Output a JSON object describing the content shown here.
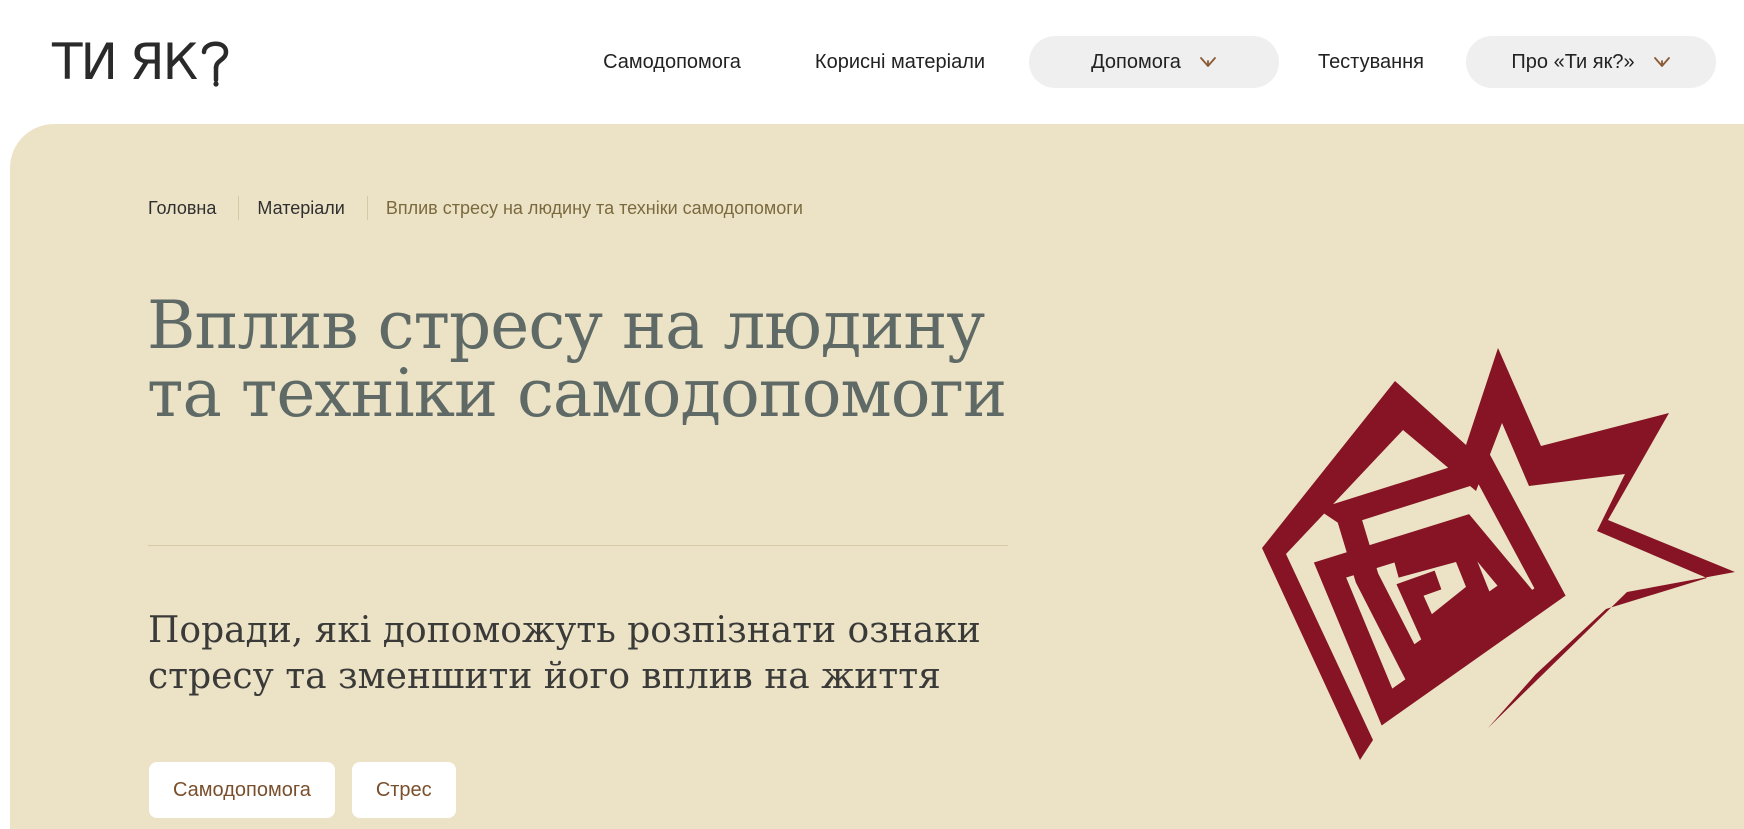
{
  "logo": {
    "text": "ТИ ЯК"
  },
  "nav": {
    "items": [
      {
        "label": "Самодопомога"
      },
      {
        "label": "Корисні матеріали"
      },
      {
        "label": "Допомога"
      },
      {
        "label": "Тестування"
      },
      {
        "label": "Про «Ти як?»"
      }
    ]
  },
  "breadcrumb": {
    "home": "Головна",
    "materials": "Матеріали",
    "current": "Вплив стресу на людину та техніки самодопомоги"
  },
  "article": {
    "title": "Вплив стресу на людину та техніки самодопомоги",
    "subtitle": "Поради, які допоможуть розпізнати ознаки стресу та зменшити його вплив на життя",
    "tags": [
      "Самодопомога",
      "Стрес"
    ]
  },
  "colors": {
    "hero_background": "#ece3c7",
    "ornament": "#861424",
    "title": "#5f6a66",
    "tag_text": "#7a4f2c",
    "chevron": "#8a5a35"
  },
  "icons": [
    "logo-question-icon",
    "chevron-down-icon",
    "spiral-ornament-illustration"
  ]
}
